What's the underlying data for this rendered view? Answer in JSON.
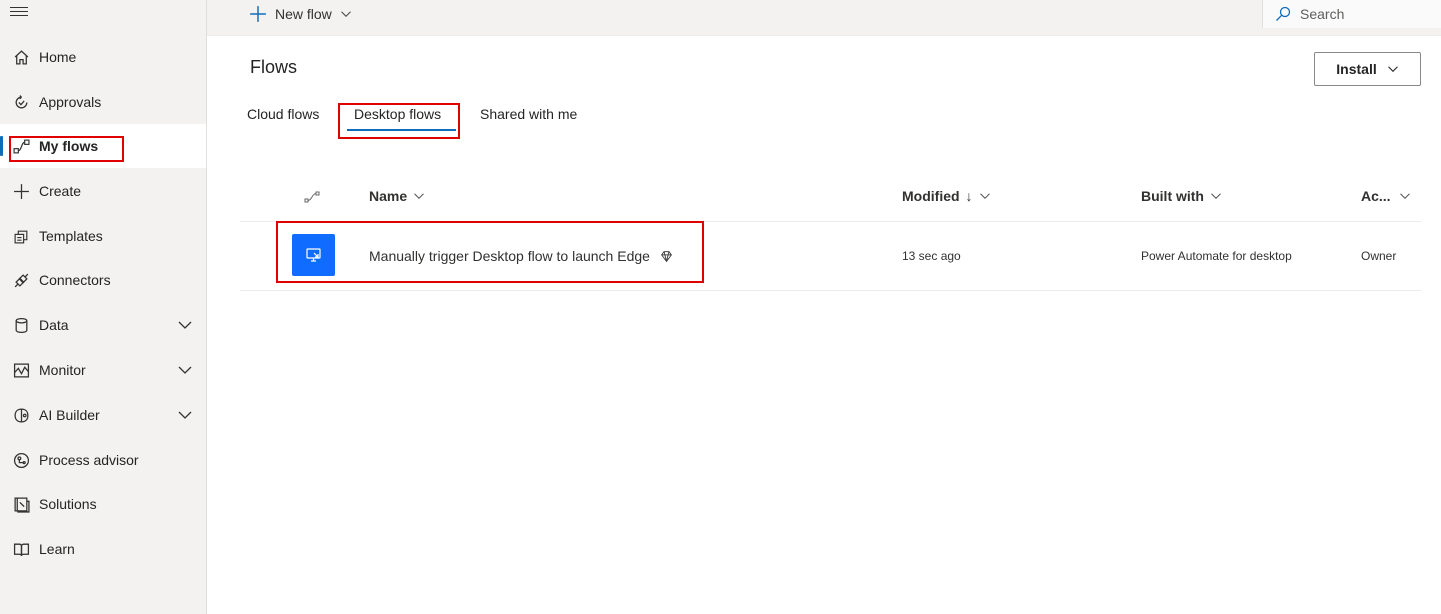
{
  "sidebar": {
    "items": [
      {
        "label": "Home",
        "icon": "home-icon"
      },
      {
        "label": "Approvals",
        "icon": "approvals-icon"
      },
      {
        "label": "My flows",
        "icon": "flow-icon"
      },
      {
        "label": "Create",
        "icon": "plus-icon"
      },
      {
        "label": "Templates",
        "icon": "templates-icon"
      },
      {
        "label": "Connectors",
        "icon": "connectors-icon"
      },
      {
        "label": "Data",
        "icon": "database-icon"
      },
      {
        "label": "Monitor",
        "icon": "monitor-icon"
      },
      {
        "label": "AI Builder",
        "icon": "brain-icon"
      },
      {
        "label": "Process advisor",
        "icon": "process-icon"
      },
      {
        "label": "Solutions",
        "icon": "solutions-icon"
      },
      {
        "label": "Learn",
        "icon": "book-icon"
      }
    ]
  },
  "topbar": {
    "new_flow_label": "New flow",
    "search_placeholder": "Search"
  },
  "main": {
    "title": "Flows",
    "install_label": "Install",
    "tabs": [
      {
        "label": "Cloud flows"
      },
      {
        "label": "Desktop flows"
      },
      {
        "label": "Shared with me"
      }
    ],
    "columns": {
      "name": "Name",
      "modified": "Modified",
      "modified_sort": "↓",
      "built_with": "Built with",
      "access": "Ac..."
    },
    "rows": [
      {
        "name": "Manually trigger Desktop flow to launch Edge",
        "modified": "13 sec ago",
        "built_with": "Power Automate for desktop",
        "access": "Owner"
      }
    ]
  },
  "colors": {
    "accent": "#0f6cbd",
    "flow_icon_bg": "#0f6cff",
    "highlight": "#e00000"
  }
}
